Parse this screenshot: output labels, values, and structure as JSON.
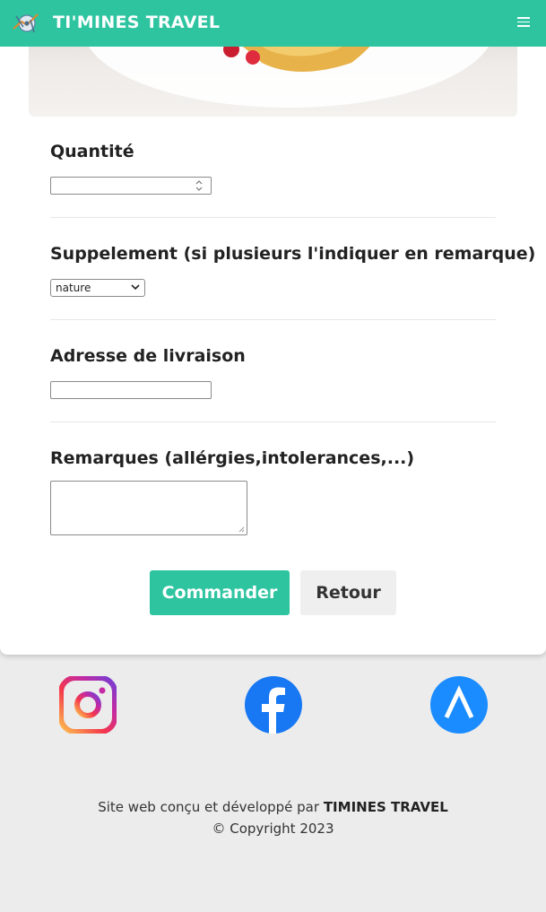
{
  "navbar": {
    "brand": "TI'MINES TRAVEL",
    "menu_icon": "menu-icon",
    "background": "#2ec4a0"
  },
  "form": {
    "quantity": {
      "label": "Quantité",
      "value": ""
    },
    "supplement": {
      "label": "Suppelement (si plusieurs l'indiquer en remarque)",
      "selected": "nature"
    },
    "address": {
      "label": "Adresse de livraison",
      "value": ""
    },
    "remarks": {
      "label": "Remarques (allérgies,intolerances,...)",
      "value": ""
    }
  },
  "buttons": {
    "order": "Commander",
    "back": "Retour"
  },
  "social": [
    "instagram-icon",
    "facebook-icon",
    "linktree-icon"
  ],
  "footer": {
    "line1_prefix": "Site web conçu et développé par",
    "line1_brand": "TIMINES TRAVEL",
    "copyright": "© Copyright 2023"
  },
  "colors": {
    "accent": "#2ec4a0",
    "facebook": "#1877f2",
    "app": "#1a8cff"
  }
}
